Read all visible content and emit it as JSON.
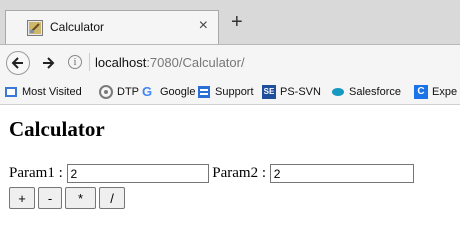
{
  "tab": {
    "title": "Calculator",
    "close_glyph": "×",
    "new_tab_glyph": "+",
    "icon": "calculator-favicon-icon"
  },
  "address": {
    "host": "localhost",
    "path": ":7080/Calculator/",
    "icon": "info-icon"
  },
  "bookmarks": [
    {
      "label": "Most Visited",
      "icon": "bookmarks-folder-icon",
      "color": "#3c78d8"
    },
    {
      "label": "DTP",
      "icon": "dtp-icon",
      "color": "#7a7a7a"
    },
    {
      "label": "Google",
      "icon": "google-icon",
      "color": "#4285f4"
    },
    {
      "label": "Support",
      "icon": "support-icon",
      "color": "#2a6fd6"
    },
    {
      "label": "PS-SVN",
      "icon": "svn-icon",
      "color": "#1f4e9a"
    },
    {
      "label": "Salesforce",
      "icon": "salesforce-icon",
      "color": "#1798c1"
    },
    {
      "label": "Expe",
      "icon": "expe-icon",
      "color": "#1a73e8"
    }
  ],
  "page": {
    "heading": "Calculator",
    "param1_label": "Param1 : ",
    "param1_value": "2",
    "param2_label": " Param2 : ",
    "param2_value": "2",
    "buttons": [
      "+",
      "-",
      "*",
      "/"
    ]
  }
}
